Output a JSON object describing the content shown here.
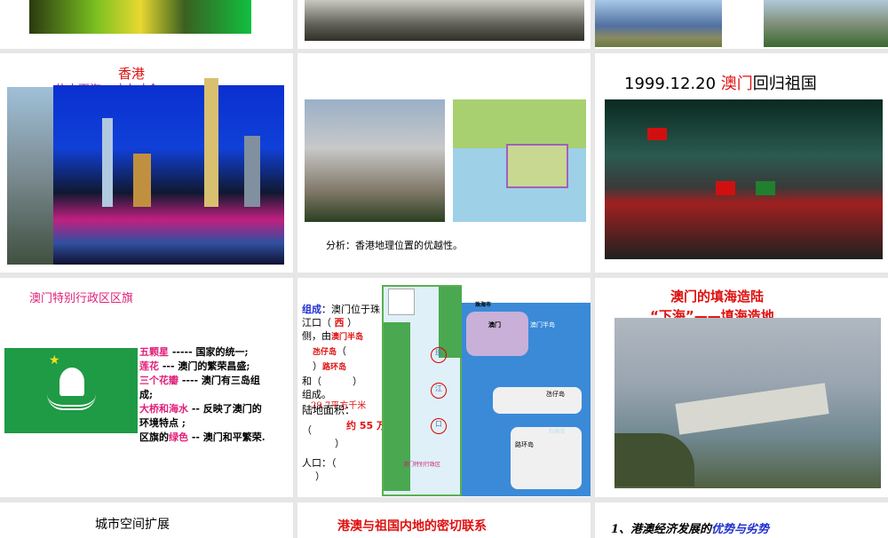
{
  "slides": [
    {
      "id": 1,
      "kind": "photo"
    },
    {
      "id": 2,
      "kind": "photo"
    },
    {
      "id": 3,
      "kind": "photo"
    },
    {
      "id": 4,
      "title": "香港",
      "subtitle": "依山面海，寸土寸金"
    },
    {
      "id": 5,
      "caption": "分析：香港地理位置的优越性。"
    },
    {
      "id": 6,
      "title_date": "1999.12.20",
      "title_highlight": "澳门",
      "title_rest": "回归祖国"
    },
    {
      "id": 7,
      "title": "澳门特别行政区区旗",
      "lines": [
        {
          "key": "五颗星",
          "rest": " ----- 国家的统一;"
        },
        {
          "key": "莲花",
          "rest": " --- 澳门的繁荣昌盛;"
        },
        {
          "key": "三个花瓣",
          "rest": " ---- 澳门有三岛组"
        },
        {
          "key": "",
          "rest": "成;"
        },
        {
          "key": "大桥和海水",
          "rest": " -- 反映了澳门的"
        },
        {
          "key": "",
          "rest": "环境特点 ;"
        },
        {
          "pre": "区旗的",
          "key": "绿色",
          "rest": " -- 澳门和平繁荣."
        }
      ]
    },
    {
      "id": 8,
      "label_composition": "组成",
      "text1": "：澳门位于珠",
      "text2": "江口（",
      "text2_end": "）",
      "answer_west": "西",
      "text3": "侧，由",
      "answer_peninsula": "澳门半岛",
      "answer_taipa": "氹仔岛",
      "answer_coloane": "路环岛",
      "text4": "和（",
      "text4_end": "）",
      "text5": "组成。",
      "answer_area": "29.7平方千米",
      "label_area": "陆地面积：",
      "paren_open": "（",
      "paren_close": "）",
      "answer_pop": "约 55 万",
      "label_pop": "人口：（",
      "map_labels": {
        "zhuhai": "珠海市",
        "gongbei": "拱北",
        "macau": "澳门",
        "peninsula": "澳门半岛",
        "taipa": "氹仔岛",
        "coloane": "路环岛",
        "sar": "澳门特别行政区",
        "bay": "石排湾",
        "river": [
          "珠",
          "江",
          "口"
        ]
      }
    },
    {
      "id": 9,
      "title": "澳门的填海造陆",
      "subtitle": "“下海”——填海造地"
    },
    {
      "id": 10,
      "title": "城市空间扩展"
    },
    {
      "id": 11,
      "title": "港澳与祖国内地的密切联系"
    },
    {
      "id": 12,
      "title_prefix": "1、港澳经济发展的",
      "title_highlight": "优势与劣势"
    }
  ],
  "colors": {
    "red": "#e01010",
    "pink": "#e0207a",
    "blue": "#2030d0",
    "flag_green": "#1f9a45",
    "background": "#e6e6e6"
  }
}
